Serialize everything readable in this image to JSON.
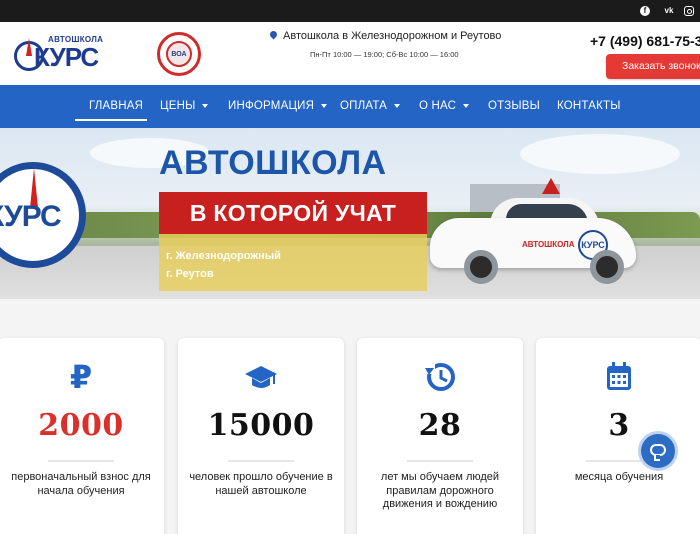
{
  "topbar": {
    "social": [
      {
        "icon": "facebook-icon",
        "glyph": "f"
      },
      {
        "icon": "vk-icon",
        "glyph": "vk"
      },
      {
        "icon": "instagram-icon",
        "glyph": ""
      }
    ]
  },
  "header": {
    "logo_subtitle": "АВТОШКОЛА",
    "logo_title": "КУРС",
    "voa_badge": "ВОА",
    "address": "Автошкола в Железнодорожном и Реутово",
    "hours": "Пн-Пт 10:00 — 19:00; Сб-Вс 10:00 — 16:00",
    "phone": "+7 (499) 681-75-3",
    "callback_label": "Заказать звонок"
  },
  "nav": {
    "items": [
      {
        "label": "ГЛАВНАЯ",
        "dropdown": false,
        "active": true
      },
      {
        "label": "ЦЕНЫ",
        "dropdown": true
      },
      {
        "label": "ИНФОРМАЦИЯ",
        "dropdown": true
      },
      {
        "label": "ОПЛАТА",
        "dropdown": true
      },
      {
        "label": "О НАС",
        "dropdown": true
      },
      {
        "label": "ОТЗЫВЫ",
        "dropdown": false
      },
      {
        "label": "КОНТАКТЫ",
        "dropdown": false
      }
    ]
  },
  "hero": {
    "title": "АВТОШКОЛА",
    "subtitle": "В КОТОРОЙ УЧАТ",
    "cities": [
      "г. Железнодорожный",
      "г. Реутов"
    ],
    "logo_text": "КУРС",
    "car_label": "АВТОШКОЛА",
    "car_logo": "КУРС"
  },
  "stats": [
    {
      "icon": "ruble-icon",
      "glyph": "₽",
      "value": "2000",
      "color": "#d9302b",
      "desc": "первоначальный взнос для начала обучения"
    },
    {
      "icon": "graduation-cap-icon",
      "glyph": "🎓",
      "value": "15000",
      "color": "#111111",
      "desc": "человек прошло обучение в нашей автошколе"
    },
    {
      "icon": "history-icon",
      "glyph": "↺",
      "value": "28",
      "color": "#111111",
      "desc": "лет мы обучаем людей правилам дорожного движения и вождению"
    },
    {
      "icon": "calendar-icon",
      "glyph": "▦",
      "value": "3",
      "color": "#111111",
      "desc": "месяца обучения"
    }
  ],
  "colors": {
    "brand_blue": "#2364c4",
    "brand_red": "#c8201f",
    "accent_red": "#e53935"
  }
}
